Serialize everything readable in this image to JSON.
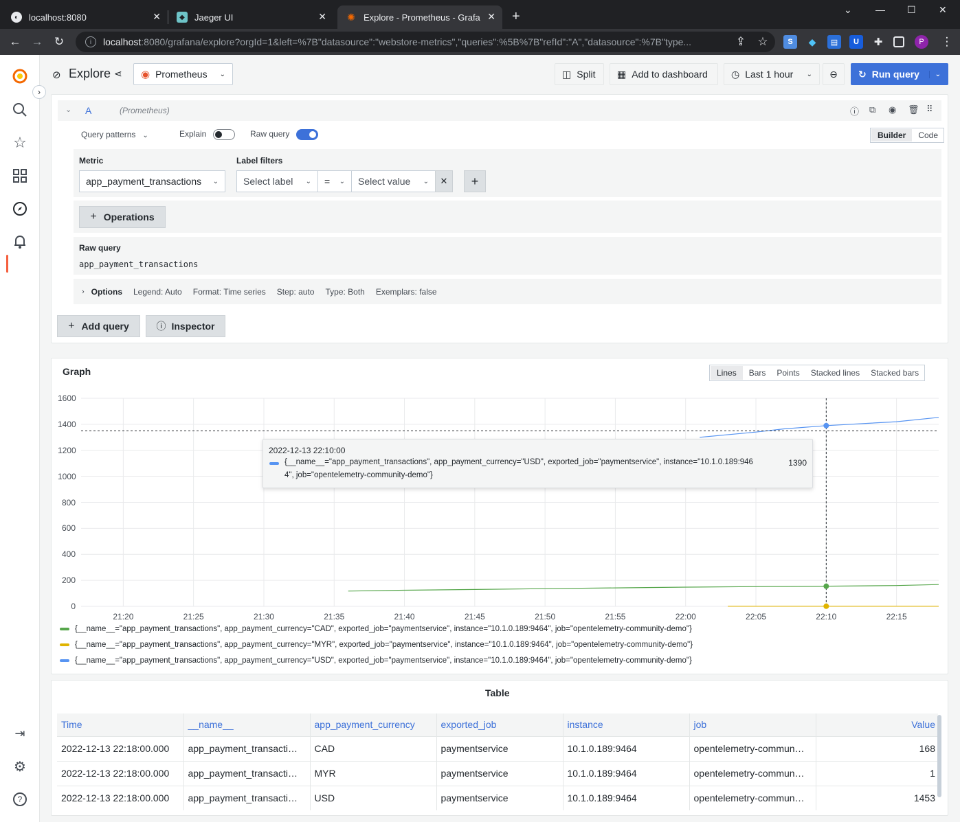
{
  "browser": {
    "tabs": [
      {
        "title": "localhost:8080"
      },
      {
        "title": "Jaeger UI"
      },
      {
        "title": "Explore - Prometheus - Grafana"
      }
    ],
    "url_host": "localhost",
    "url_rest": ":8080/grafana/explore?orgId=1&left=%7B\"datasource\":\"webstore-metrics\",\"queries\":%5B%7B\"refId\":\"A\",\"datasource\":%7B\"type...",
    "profile_initial": "P"
  },
  "topbar": {
    "title": "Explore",
    "datasource": "Prometheus",
    "split": "Split",
    "add_dashboard": "Add to dashboard",
    "time_range": "Last 1 hour",
    "run_query": "Run query"
  },
  "query": {
    "ref": "A",
    "datasource_hint": "(Prometheus)",
    "query_patterns": "Query patterns",
    "explain": "Explain",
    "raw_query_toggle": "Raw query",
    "builder": "Builder",
    "code": "Code",
    "metric_label": "Metric",
    "metric_value": "app_payment_transactions",
    "label_filters": "Label filters",
    "select_label": "Select label",
    "operator": "=",
    "select_value": "Select value",
    "operations": "Operations",
    "raw_query_title": "Raw query",
    "raw_query": "app_payment_transactions",
    "options": {
      "title": "Options",
      "legend": "Legend: Auto",
      "format": "Format: Time series",
      "step": "Step: auto",
      "type": "Type: Both",
      "exemplars": "Exemplars: false"
    },
    "add_query": "Add query",
    "inspector": "Inspector"
  },
  "graph": {
    "title": "Graph",
    "view_modes": [
      "Lines",
      "Bars",
      "Points",
      "Stacked lines",
      "Stacked bars"
    ],
    "selected_mode": "Lines",
    "tooltip": {
      "time": "2022-12-13 22:10:00",
      "series": "{__name__=\"app_payment_transactions\", app_payment_currency=\"USD\", exported_job=\"paymentservice\", instance=\"10.1.0.189:946",
      "series_cont": "4\", job=\"opentelemetry-community-demo\"}",
      "value": "1390"
    }
  },
  "chart_data": {
    "type": "line",
    "ylim": [
      0,
      1600
    ],
    "y_ticks": [
      "1600",
      "1400",
      "1200",
      "1000",
      "800",
      "600",
      "400",
      "200",
      "0"
    ],
    "x_ticks": [
      "21:20",
      "21:25",
      "21:30",
      "21:35",
      "21:40",
      "21:45",
      "21:50",
      "21:55",
      "22:00",
      "22:05",
      "22:10",
      "22:15"
    ],
    "series": [
      {
        "name": "{__name__=\"app_payment_transactions\", app_payment_currency=\"CAD\", exported_job=\"paymentservice\", instance=\"10.1.0.189:9464\", job=\"opentelemetry-community-demo\"}",
        "color": "#56a64b",
        "x": [
          "21:36",
          "21:40",
          "21:45",
          "21:50",
          "21:55",
          "22:00",
          "22:06",
          "22:07",
          "22:10",
          "22:15",
          "22:18"
        ],
        "values": [
          118,
          124,
          130,
          136,
          142,
          148,
          153,
          153,
          155,
          160,
          168
        ]
      },
      {
        "name": "{__name__=\"app_payment_transactions\", app_payment_currency=\"MYR\", exported_job=\"paymentservice\", instance=\"10.1.0.189:9464\", job=\"opentelemetry-community-demo\"}",
        "color": "#e0b400",
        "x": [
          "22:03",
          "22:06",
          "22:07",
          "22:10",
          "22:18"
        ],
        "values": [
          1,
          1,
          1,
          1,
          1
        ]
      },
      {
        "name": "{__name__=\"app_payment_transactions\", app_payment_currency=\"USD\", exported_job=\"paymentservice\", instance=\"10.1.0.189:9464\", job=\"opentelemetry-community-demo\"}",
        "color": "#5794f2",
        "x": [
          "22:01",
          "22:05",
          "22:07",
          "22:10",
          "22:15",
          "22:18"
        ],
        "values": [
          1300,
          1340,
          1365,
          1390,
          1420,
          1453
        ]
      }
    ],
    "cursor_x": "22:10",
    "cursor_y": 1350
  },
  "table": {
    "title": "Table",
    "columns": [
      "Time",
      "__name__",
      "app_payment_currency",
      "exported_job",
      "instance",
      "job",
      "Value"
    ],
    "rows": [
      [
        "2022-12-13 22:18:00.000",
        "app_payment_transacti…",
        "CAD",
        "paymentservice",
        "10.1.0.189:9464",
        "opentelemetry-commun…",
        "168"
      ],
      [
        "2022-12-13 22:18:00.000",
        "app_payment_transacti…",
        "MYR",
        "paymentservice",
        "10.1.0.189:9464",
        "opentelemetry-commun…",
        "1"
      ],
      [
        "2022-12-13 22:18:00.000",
        "app_payment_transacti…",
        "USD",
        "paymentservice",
        "10.1.0.189:9464",
        "opentelemetry-commun…",
        "1453"
      ]
    ]
  }
}
